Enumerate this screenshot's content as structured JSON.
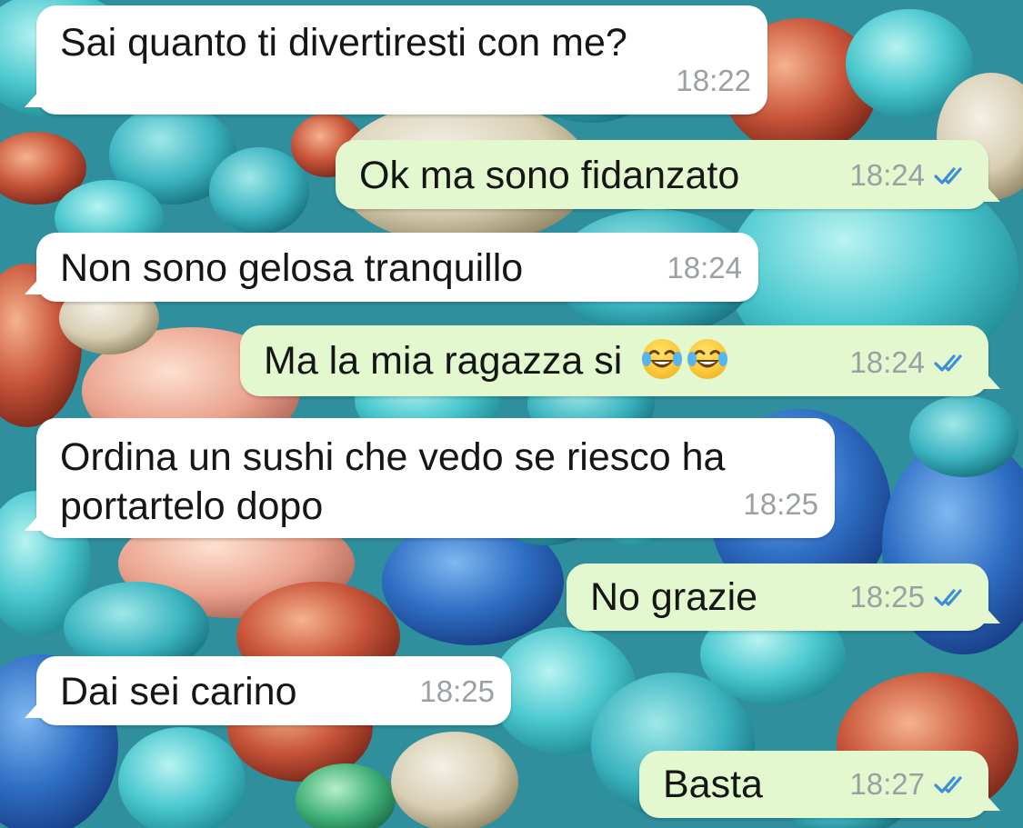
{
  "chat": {
    "messages": [
      {
        "direction": "incoming",
        "text": "Sai quanto ti divertiresti con me?",
        "time": "18:22"
      },
      {
        "direction": "outgoing",
        "text": "Ok ma sono fidanzato",
        "time": "18:24",
        "status": "read",
        "status_icon": "double-check-icon"
      },
      {
        "direction": "incoming",
        "text": "Non sono gelosa tranquillo",
        "time": "18:24"
      },
      {
        "direction": "outgoing",
        "text": "Ma la mia ragazza si",
        "emojis": [
          "face-with-tears-of-joy",
          "face-with-tears-of-joy"
        ],
        "time": "18:24",
        "status": "read",
        "status_icon": "double-check-icon"
      },
      {
        "direction": "incoming",
        "text": "Ordina un sushi che vedo se riesco ha\nportartelo dopo",
        "time": "18:25"
      },
      {
        "direction": "outgoing",
        "text": "No grazie",
        "time": "18:25",
        "status": "read",
        "status_icon": "double-check-icon"
      },
      {
        "direction": "incoming",
        "text": "Dai sei carino",
        "time": "18:25"
      },
      {
        "direction": "outgoing",
        "text": "Basta",
        "time": "18:27",
        "status": "read",
        "status_icon": "double-check-icon"
      }
    ]
  },
  "colors": {
    "incoming_bubble": "#ffffff",
    "outgoing_bubble": "#e3f8cf",
    "read_ticks": "#3b8fd6",
    "timestamp": "#9aa0a4"
  }
}
